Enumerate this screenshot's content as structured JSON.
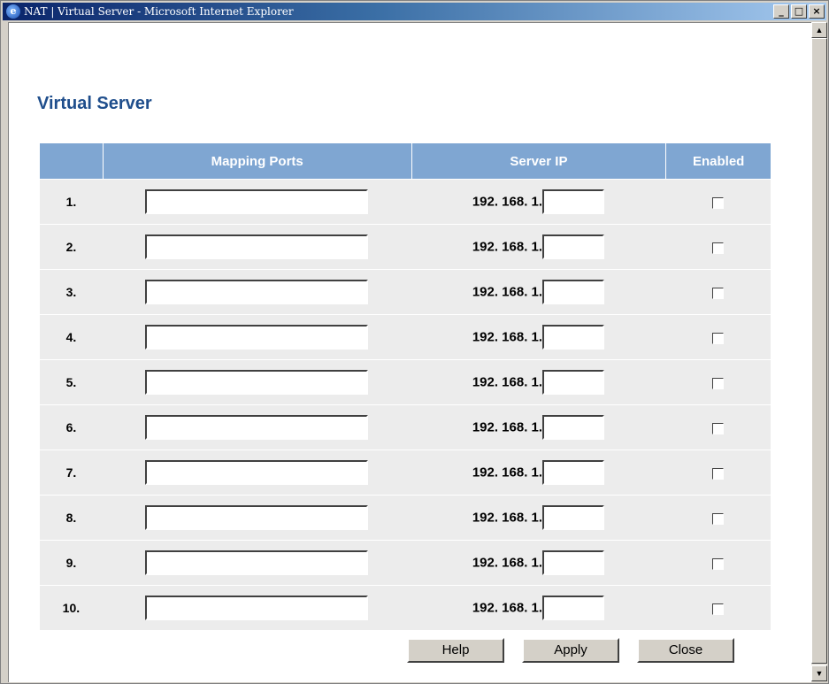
{
  "window": {
    "title": "NAT | Virtual Server - Microsoft Internet Explorer"
  },
  "page": {
    "title": "Virtual Server"
  },
  "table": {
    "headers": [
      "",
      "Mapping Ports",
      "Server IP",
      "Enabled"
    ],
    "ip_prefix": "192. 168. 1.",
    "rows": [
      {
        "num": "1.",
        "mapping_ports": "",
        "server_ip_suffix": "",
        "enabled": false
      },
      {
        "num": "2.",
        "mapping_ports": "",
        "server_ip_suffix": "",
        "enabled": false
      },
      {
        "num": "3.",
        "mapping_ports": "",
        "server_ip_suffix": "",
        "enabled": false
      },
      {
        "num": "4.",
        "mapping_ports": "",
        "server_ip_suffix": "",
        "enabled": false
      },
      {
        "num": "5.",
        "mapping_ports": "",
        "server_ip_suffix": "",
        "enabled": false
      },
      {
        "num": "6.",
        "mapping_ports": "",
        "server_ip_suffix": "",
        "enabled": false
      },
      {
        "num": "7.",
        "mapping_ports": "",
        "server_ip_suffix": "",
        "enabled": false
      },
      {
        "num": "8.",
        "mapping_ports": "",
        "server_ip_suffix": "",
        "enabled": false
      },
      {
        "num": "9.",
        "mapping_ports": "",
        "server_ip_suffix": "",
        "enabled": false
      },
      {
        "num": "10.",
        "mapping_ports": "",
        "server_ip_suffix": "",
        "enabled": false
      }
    ]
  },
  "buttons": {
    "help": "Help",
    "apply": "Apply",
    "close": "Close"
  },
  "colors": {
    "header_bg": "#7fa6d2",
    "title_color": "#1f4e8c",
    "row_bg": "#ececec"
  },
  "icons": {
    "app": "ie-icon",
    "minimize": "minimize-icon",
    "maximize": "maximize-icon",
    "close": "close-icon",
    "scroll_up": "arrow-up-icon",
    "scroll_down": "arrow-down-icon"
  }
}
